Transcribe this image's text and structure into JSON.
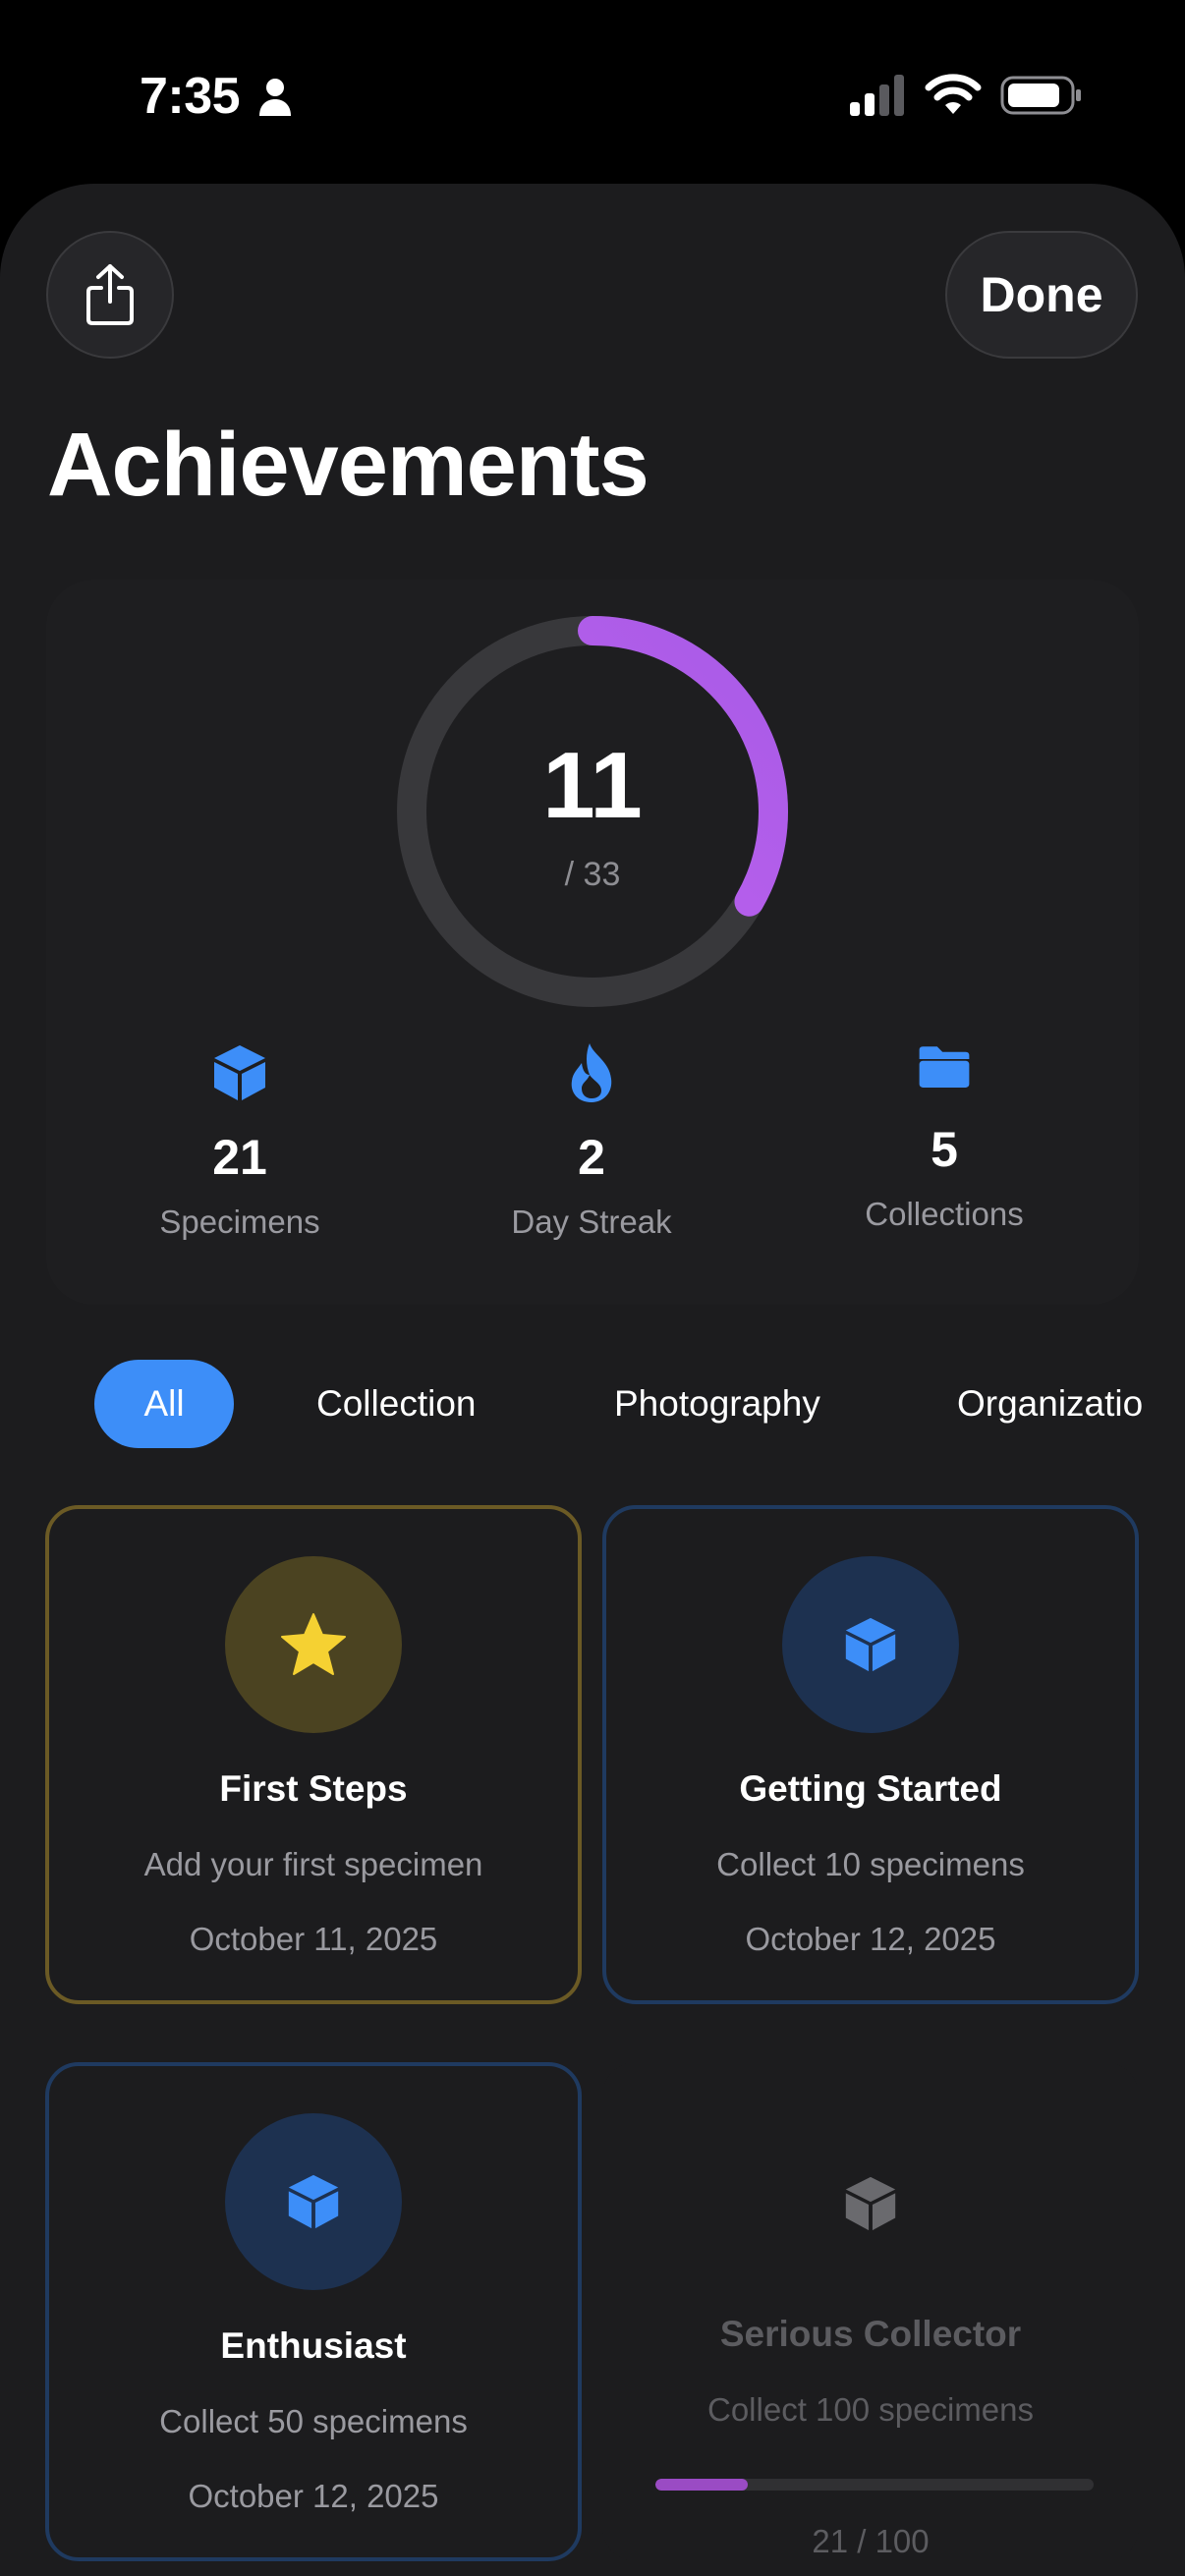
{
  "status_bar": {
    "time": "7:35",
    "icons": [
      "person-icon",
      "cellular-signal-icon",
      "wifi-icon",
      "battery-icon"
    ]
  },
  "header": {
    "share_icon": "share-icon",
    "done_label": "Done",
    "title": "Achievements"
  },
  "summary": {
    "unlocked": "11",
    "total_label": "/ 33",
    "progress_fraction": 0.333,
    "ring_color": "#bf5af2",
    "stats": [
      {
        "icon": "cube-icon",
        "value": "21",
        "label": "Specimens"
      },
      {
        "icon": "flame-icon",
        "value": "2",
        "label": "Day Streak"
      },
      {
        "icon": "folder-icon",
        "value": "5",
        "label": "Collections"
      }
    ]
  },
  "filters": {
    "items": [
      "All",
      "Collection",
      "Photography",
      "Organization"
    ],
    "selected": "All",
    "accent": "#3d8ef8"
  },
  "achievements": [
    {
      "icon": "star-icon",
      "name": "First Steps",
      "description": "Add your first specimen",
      "date": "October 11, 2025",
      "tier": "gold"
    },
    {
      "icon": "cube-icon",
      "name": "Getting Started",
      "description": "Collect 10 specimens",
      "date": "October 12, 2025",
      "tier": "blue"
    },
    {
      "icon": "cube-icon",
      "name": "Enthusiast",
      "description": "Collect 50 specimens",
      "date": "October 12, 2025",
      "tier": "blue"
    },
    {
      "icon": "cube-icon",
      "name": "Serious Collector",
      "description": "Collect 100 specimens",
      "progress_text": "21 / 100",
      "progress_fraction": 0.21,
      "tier": "locked"
    }
  ]
}
